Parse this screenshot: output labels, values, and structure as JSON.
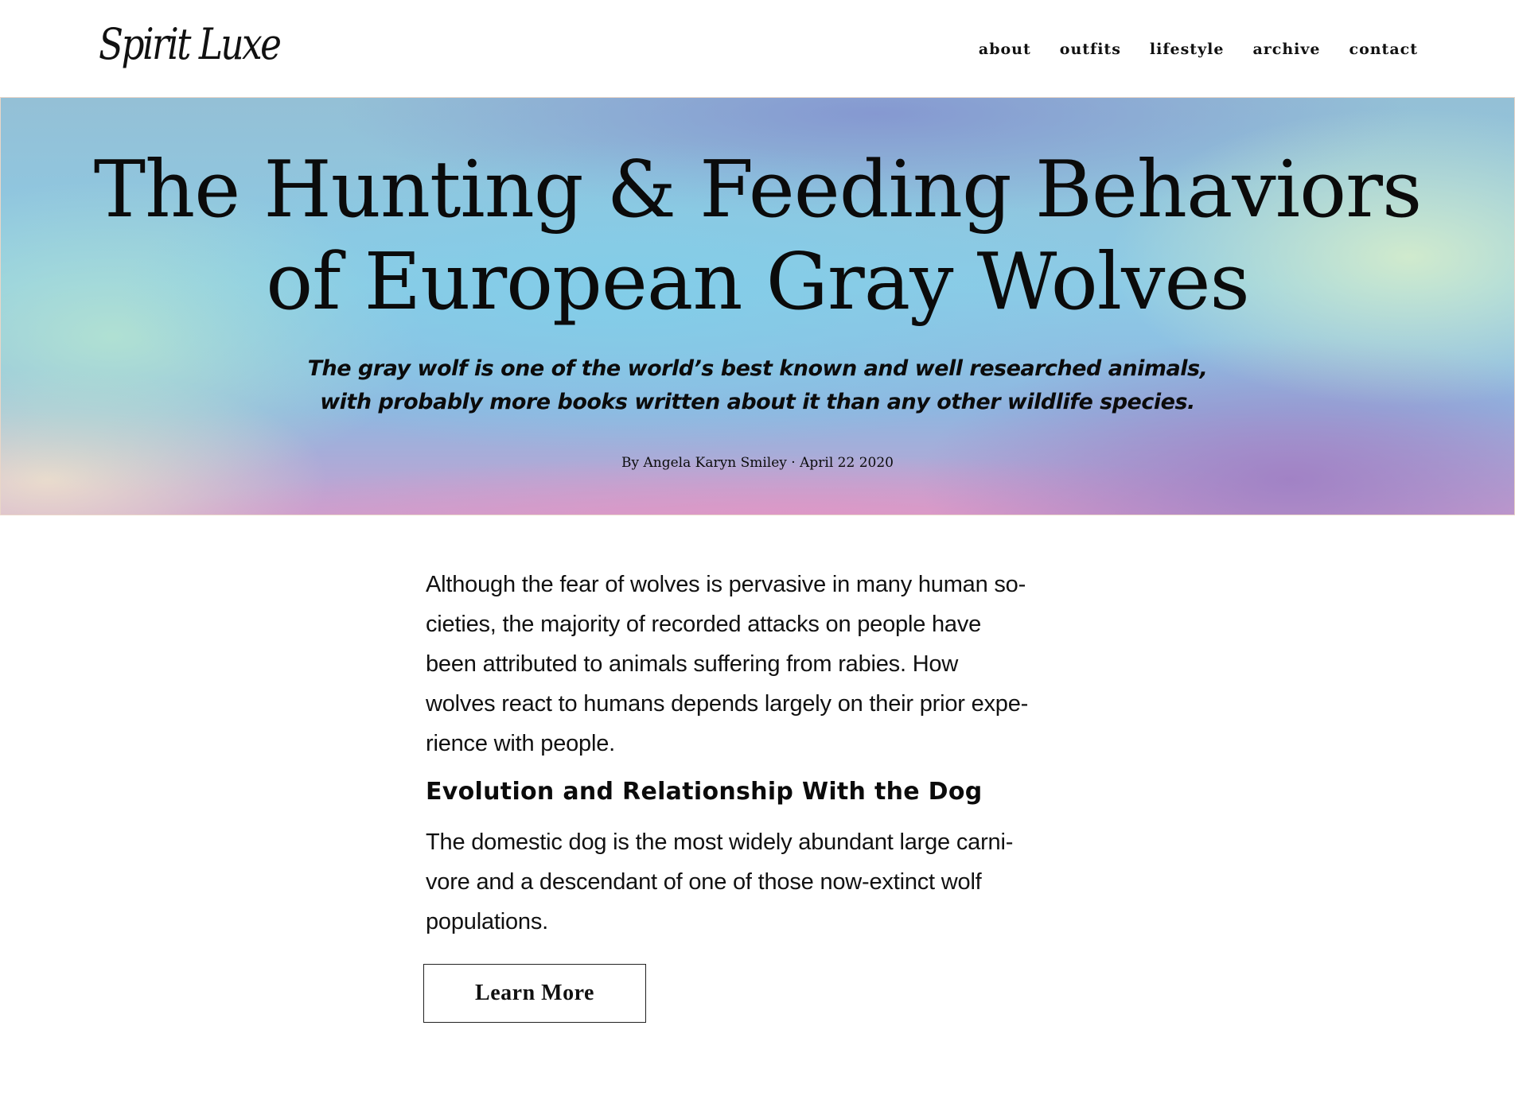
{
  "header": {
    "logo": "Spirit Luxe",
    "nav": [
      "about",
      "outfits",
      "lifestyle",
      "archive",
      "contact"
    ]
  },
  "hero": {
    "title_lines": [
      "The Hunting & Feeding Behaviors",
      "of European Gray Wolves"
    ],
    "subtitle_lines": [
      "The gray wolf is one of the world’s best known and well researched animals,",
      "with probably more books written about it than any other wildlife species."
    ],
    "byline": "By Angela Karyn Smiley · April 22 2020",
    "gradient_colors": [
      "#8ccbe6",
      "#b2e2d2",
      "#d4eccc",
      "#a080c4",
      "#e296c4",
      "#8494d0"
    ]
  },
  "article": {
    "paragraph1_lines": [
      "Although the fear of wolves is pervasive in many human so-",
      "cieties, the majority of recorded attacks on people have",
      "been attributed to animals suffering from rabies. How",
      "wolves react to humans depends largely on their prior expe-",
      "rience with people."
    ],
    "heading": "Evolution and Relationship With the Dog",
    "paragraph2_lines": [
      "The domestic dog is the most widely abundant large carni-",
      "vore and a descendant of one of those now-extinct wolf",
      "populations."
    ],
    "button_label": "Learn More"
  }
}
